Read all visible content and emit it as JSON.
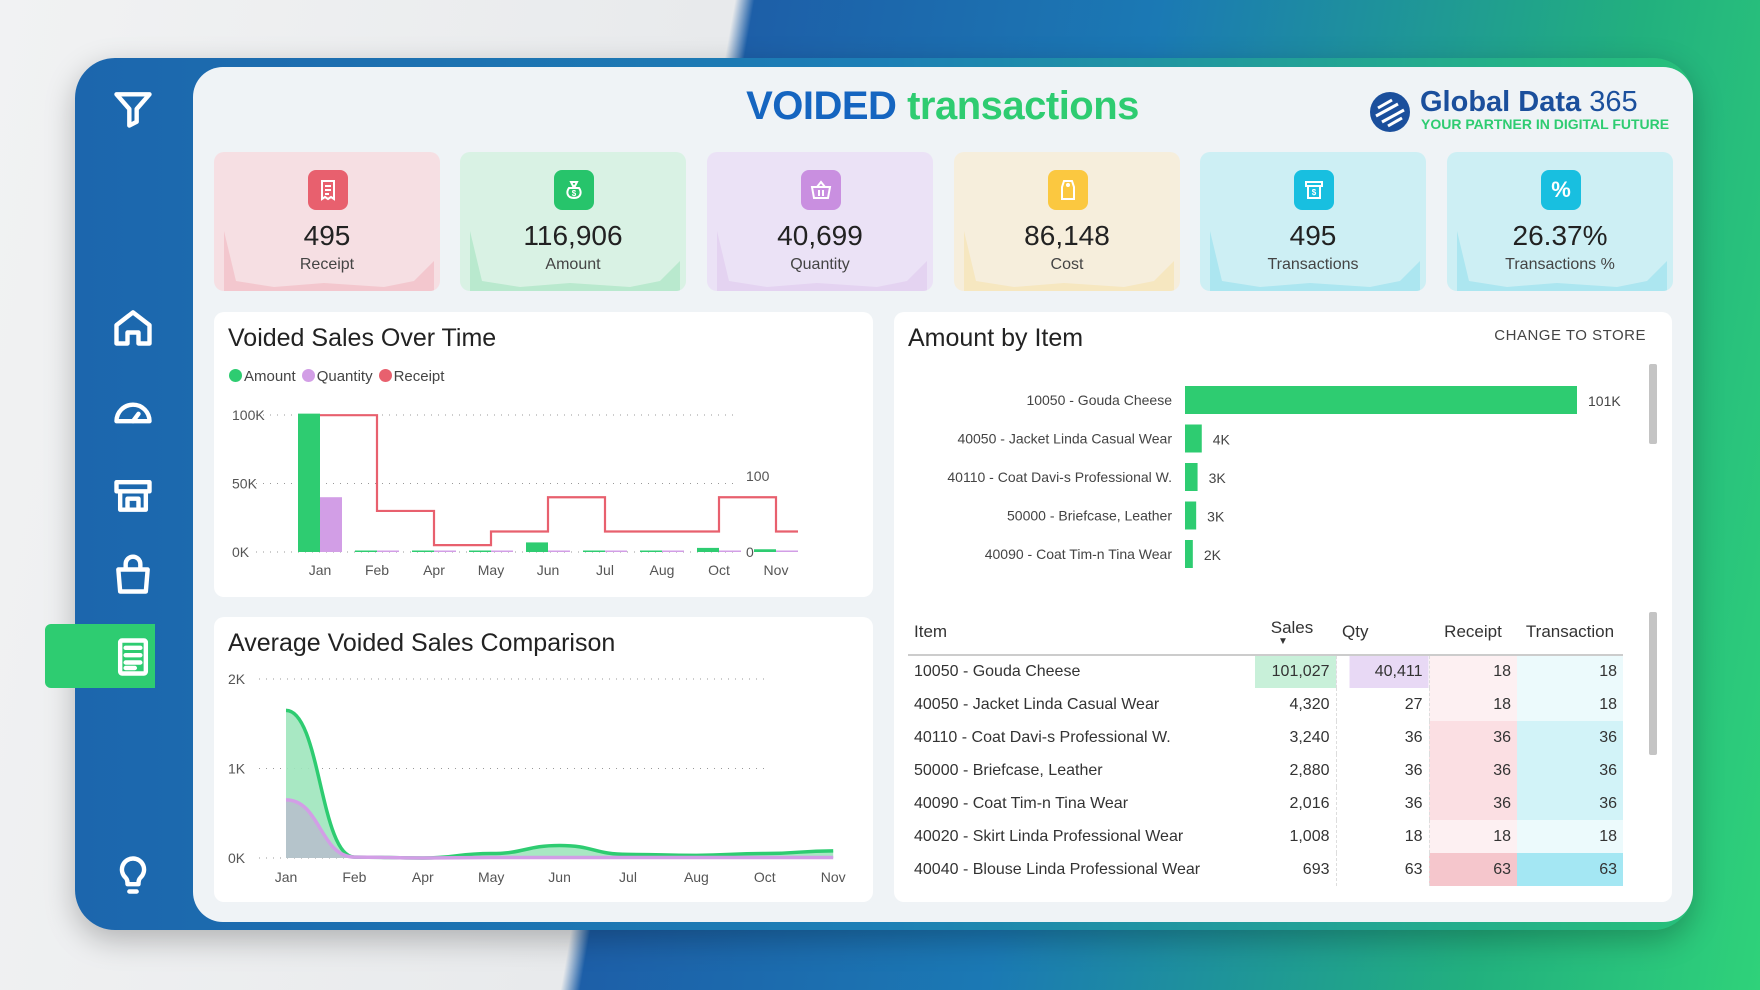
{
  "header": {
    "title_bold": "VOIDED",
    "title_rest": "transactions",
    "logo_name": "Global Data",
    "logo_number": "365",
    "logo_tagline": "YOUR PARTNER IN DIGITAL FUTURE"
  },
  "sidebar": {
    "items": [
      {
        "icon": "filter-icon"
      },
      {
        "icon": "home-icon"
      },
      {
        "icon": "speedometer-icon"
      },
      {
        "icon": "store-icon"
      },
      {
        "icon": "shopping-bag-icon"
      },
      {
        "icon": "report-icon",
        "active": true
      },
      {
        "icon": "lightbulb-icon"
      }
    ],
    "active_color": "#2ecc71"
  },
  "kpis": [
    {
      "value": "495",
      "label": "Receipt",
      "icon": "receipt-icon",
      "color": "#e8606e",
      "bg": "#f6dfe3"
    },
    {
      "value": "116,906",
      "label": "Amount",
      "icon": "money-bag-icon",
      "color": "#27c46b",
      "bg": "#d9f2e4"
    },
    {
      "value": "40,699",
      "label": "Quantity",
      "icon": "basket-icon",
      "color": "#c98fe0",
      "bg": "#ebe2f6"
    },
    {
      "value": "86,148",
      "label": "Cost",
      "icon": "price-tag-icon",
      "color": "#fbc840",
      "bg": "#f6eedc"
    },
    {
      "value": "495",
      "label": "Transactions",
      "icon": "register-icon",
      "color": "#18bfe0",
      "bg": "#cdeff4"
    },
    {
      "value": "26.37%",
      "label": "Transactions %",
      "icon": "percent-icon",
      "color": "#18bfe0",
      "bg": "#cdeff4"
    }
  ],
  "right_panel": {
    "title": "Amount by Item",
    "change_label": "CHANGE TO STORE"
  },
  "chart_data": [
    {
      "type": "bar",
      "title": "Voided Sales Over Time",
      "categories": [
        "Jan",
        "Feb",
        "Apr",
        "May",
        "Jun",
        "Jul",
        "Aug",
        "Oct",
        "Nov"
      ],
      "legend": [
        "Amount",
        "Quantity",
        "Receipt"
      ],
      "legend_position": "top-left",
      "series": [
        {
          "name": "Amount",
          "color": "#2ecc71",
          "axis": "left",
          "values": [
            101000,
            0,
            0,
            500,
            7000,
            500,
            500,
            3000,
            2000
          ]
        },
        {
          "name": "Quantity",
          "color": "#d29ee6",
          "axis": "left",
          "values": [
            40000,
            0,
            0,
            300,
            300,
            300,
            300,
            300,
            300
          ]
        },
        {
          "name": "Receipt",
          "color": "#e8606e",
          "axis": "right",
          "kind": "step-line",
          "values": [
            180,
            54,
            9,
            27,
            72,
            27,
            27,
            72,
            27
          ]
        }
      ],
      "y_ticks": [
        "100K",
        "50K",
        "0K"
      ],
      "ylim": [
        0,
        100000
      ],
      "y2_ticks": [
        "100",
        "0"
      ],
      "y2lim": [
        0,
        100
      ],
      "grid": true
    },
    {
      "type": "area",
      "title": "Average Voided Sales Comparison",
      "categories": [
        "Jan",
        "Feb",
        "Apr",
        "May",
        "Jun",
        "Jul",
        "Aug",
        "Oct",
        "Nov"
      ],
      "series": [
        {
          "color": "#2ecc71",
          "values": [
            1650,
            10,
            0,
            50,
            140,
            40,
            30,
            50,
            80
          ]
        },
        {
          "color": "#d29ee6",
          "values": [
            650,
            10,
            0,
            5,
            5,
            5,
            5,
            5,
            5
          ]
        }
      ],
      "y_ticks": [
        "2K",
        "1K",
        "0K"
      ],
      "ylim": [
        0,
        2000
      ],
      "grid": true
    },
    {
      "type": "bar",
      "orientation": "horizontal",
      "categories": [
        "10050 - Gouda Cheese",
        "40050 - Jacket Linda Casual Wear",
        "40110 - Coat Davi-s Professional W.",
        "50000 - Briefcase, Leather",
        "40090 - Coat Tim-n Tina Wear"
      ],
      "values": [
        101027,
        4320,
        3240,
        2880,
        2016
      ],
      "labels": [
        "101K",
        "4K",
        "3K",
        "3K",
        "2K"
      ],
      "color": "#2ecc71"
    }
  ],
  "table": {
    "columns": [
      "Item",
      "Sales",
      "Qty",
      "Receipt",
      "Transaction"
    ],
    "sort_column": "Sales",
    "rows": [
      [
        "10050 - Gouda Cheese",
        "101,027",
        "40,411",
        "18",
        "18"
      ],
      [
        "40050 - Jacket Linda Casual Wear",
        "4,320",
        "27",
        "18",
        "18"
      ],
      [
        "40110 - Coat Davi-s Professional W.",
        "3,240",
        "36",
        "36",
        "36"
      ],
      [
        "50000 - Briefcase, Leather",
        "2,880",
        "36",
        "36",
        "36"
      ],
      [
        "40090 - Coat Tim-n Tina Wear",
        "2,016",
        "36",
        "36",
        "36"
      ],
      [
        "40020 - Skirt Linda Professional Wear",
        "1,008",
        "18",
        "18",
        "18"
      ],
      [
        "40040 - Blouse Linda Professional Wear",
        "693",
        "63",
        "63",
        "63"
      ]
    ]
  }
}
